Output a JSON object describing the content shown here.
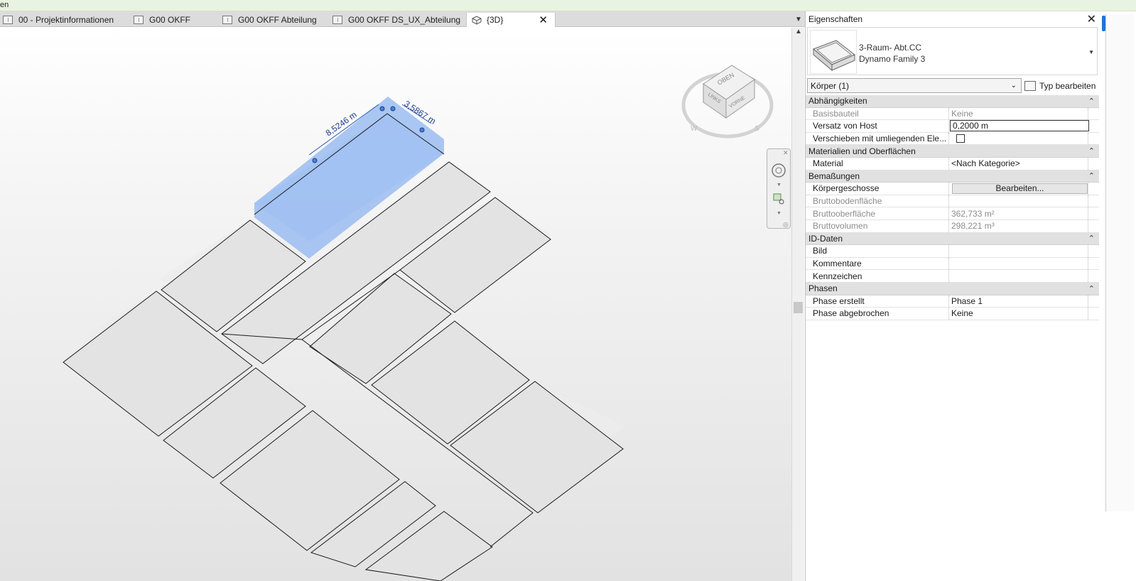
{
  "top_strip": {
    "text": "en"
  },
  "tabs": [
    {
      "label": "00 - Projektinformationen",
      "active": false
    },
    {
      "label": "G00 OKFF",
      "active": false
    },
    {
      "label": "G00 OKFF Abteilung",
      "active": false
    },
    {
      "label": "G00 OKFF DS_UX_Abteilung",
      "active": false
    },
    {
      "label": "{3D}",
      "active": true
    }
  ],
  "tab_close": "✕",
  "viewport": {
    "dim_long": "8,5246 m",
    "dim_short": "3,5867 m",
    "viewcube": {
      "top": "OBEN",
      "left": "LINKS",
      "front": "VORNE",
      "compass_w": "W",
      "compass_s": "S"
    },
    "selection_color": "#8fb4f0"
  },
  "properties": {
    "title": "Eigenschaften",
    "close": "✕",
    "type_line1": "3-Raum- Abt.CC",
    "type_line2": "Dynamo Family 3",
    "instance_filter": "Körper (1)",
    "type_edit": "Typ bearbeiten",
    "groups": [
      {
        "name": "Abhängigkeiten",
        "rows": [
          {
            "label": "Basisbauteil",
            "value": "Keine",
            "disabled": true
          },
          {
            "label": "Versatz von Host",
            "value": "0,2000 m",
            "editing": true
          },
          {
            "label": "Verschieben mit umliegenden Ele...",
            "value": "",
            "checkbox": true
          }
        ]
      },
      {
        "name": "Materialien und Oberflächen",
        "rows": [
          {
            "label": "Material",
            "value": "<Nach Kategorie>"
          }
        ]
      },
      {
        "name": "Bemaßungen",
        "rows": [
          {
            "label": "Körpergeschosse",
            "value": "Bearbeiten...",
            "button": true
          },
          {
            "label": "Bruttobodenfläche",
            "value": "",
            "disabled": true
          },
          {
            "label": "Bruttooberfläche",
            "value": "362,733 m²",
            "disabled": true
          },
          {
            "label": "Bruttovolumen",
            "value": "298,221 m³",
            "disabled": true
          }
        ]
      },
      {
        "name": "ID-Daten",
        "rows": [
          {
            "label": "Bild",
            "value": ""
          },
          {
            "label": "Kommentare",
            "value": ""
          },
          {
            "label": "Kennzeichen",
            "value": ""
          }
        ]
      },
      {
        "name": "Phasen",
        "rows": [
          {
            "label": "Phase erstellt",
            "value": "Phase 1"
          },
          {
            "label": "Phase abgebrochen",
            "value": "Keine"
          }
        ]
      }
    ],
    "collapse_glyph": "⌃"
  }
}
